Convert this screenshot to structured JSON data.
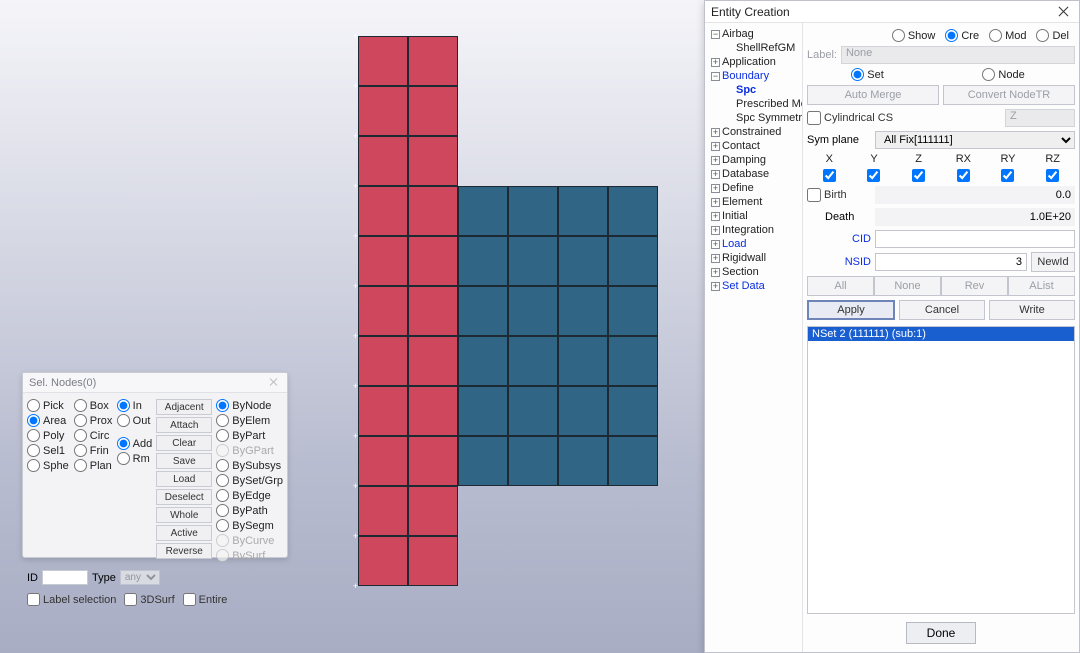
{
  "viewport": {
    "red_cols": 2,
    "red_rows": 11,
    "blue_cols": 4,
    "blue_rows": 6
  },
  "sel_panel": {
    "title": "Sel. Nodes(0)",
    "shapes": {
      "pick": "Pick",
      "area": "Area",
      "poly": "Poly",
      "sel1": "Sel1",
      "sphe": "Sphe",
      "box": "Box",
      "prox": "Prox",
      "circ": "Circ",
      "frin": "Frin",
      "plan": "Plan"
    },
    "inout": {
      "in": "In",
      "out": "Out"
    },
    "bool": {
      "add": "Add",
      "rm": "Rm"
    },
    "buttons": {
      "adjacent": "Adjacent",
      "attach": "Attach",
      "clear": "Clear",
      "save": "Save",
      "load": "Load",
      "deselect": "Deselect",
      "whole": "Whole",
      "active": "Active",
      "reverse": "Reverse"
    },
    "by": {
      "bynode": "ByNode",
      "byelem": "ByElem",
      "bypart": "ByPart",
      "bygpart": "ByGPart",
      "bysubsys": "BySubsys",
      "bysetgrp": "BySet/Grp",
      "byedge": "ByEdge",
      "bypath": "ByPath",
      "bysegm": "BySegm",
      "bycurve": "ByCurve",
      "bysurf": "BySurf"
    },
    "id_label": "ID",
    "type_label": "Type",
    "type_value": "any",
    "label_selection": "Label selection",
    "tdsurf": "3DSurf",
    "entire": "Entire"
  },
  "entity": {
    "window_title": "Entity Creation",
    "tree": {
      "airbag": "Airbag",
      "shellrefgm": "ShellRefGM",
      "application": "Application",
      "boundary": "Boundary",
      "spc": "Spc",
      "prescribed": "Prescribed Motion(BPM)",
      "sym": "Spc Symmetry Plane",
      "constrained": "Constrained",
      "contact": "Contact",
      "damping": "Damping",
      "database": "Database",
      "define": "Define",
      "element": "Element",
      "initial": "Initial",
      "integration": "Integration",
      "load": "Load",
      "rigidwall": "Rigidwall",
      "section": "Section",
      "setdata": "Set Data"
    },
    "mode": {
      "show": "Show",
      "cre": "Cre",
      "mod": "Mod",
      "del": "Del"
    },
    "label_lbl": "Label:",
    "label_sel": "None",
    "setnode": {
      "set": "Set",
      "node": "Node"
    },
    "automerge": "Auto Merge",
    "convertnode": "Convert NodeTR",
    "cyl": "Cylindrical CS",
    "cyl_val": "Z",
    "symplane": "Sym plane",
    "symplane_val": "All Fix[111111]",
    "dof": {
      "x": "X",
      "y": "Y",
      "z": "Z",
      "rx": "RX",
      "ry": "RY",
      "rz": "RZ"
    },
    "birth": "Birth",
    "birth_val": "0.0",
    "death": "Death",
    "death_val": "1.0E+20",
    "cid": "CID",
    "cid_val": "",
    "nsid": "NSID",
    "nsid_val": "3",
    "newid": "NewId",
    "nav": {
      "all": "All",
      "none": "None",
      "rev": "Rev",
      "alist": "AList"
    },
    "apply": "Apply",
    "cancel": "Cancel",
    "write": "Write",
    "list_item": "NSet 2 (111111) (sub:1)",
    "done": "Done"
  }
}
